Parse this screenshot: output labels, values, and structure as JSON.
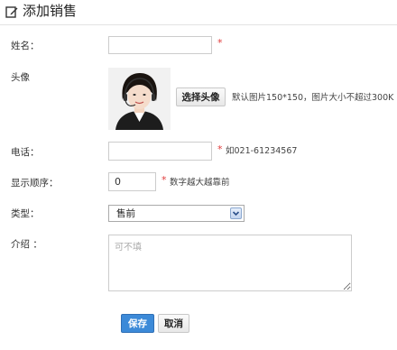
{
  "header": {
    "title": "添加销售",
    "icon": "edit-icon"
  },
  "form": {
    "name": {
      "label": "姓名：",
      "value": "",
      "required_mark": "*"
    },
    "avatar": {
      "label": "头像",
      "upload_button": "选择头像",
      "hint": "默认图片150*150，图片大小不超过300K"
    },
    "phone": {
      "label": "电话：",
      "value": "",
      "required_mark": "*",
      "hint": "如021-61234567"
    },
    "order": {
      "label": "显示顺序：",
      "value": "0",
      "required_mark": "*",
      "hint": "数字越大越靠前"
    },
    "type": {
      "label": "类型：",
      "selected": "售前"
    },
    "intro": {
      "label": "介绍 ：",
      "placeholder": "可不填"
    }
  },
  "actions": {
    "save_label": "保存",
    "cancel_label": "取消"
  },
  "colors": {
    "required": "#e03a3a",
    "primary_button": "#3c8ad8",
    "border": "#cccccc"
  }
}
